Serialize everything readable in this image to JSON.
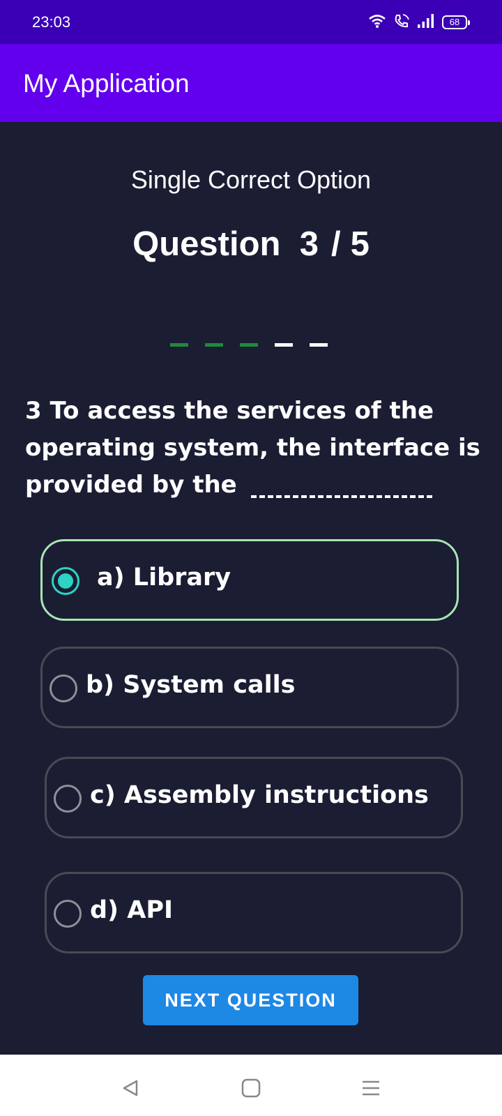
{
  "status_bar": {
    "time": "23:03",
    "battery": "68",
    "icons": [
      "wifi-icon",
      "call-icon",
      "signal-icon",
      "battery-icon"
    ]
  },
  "app_bar": {
    "title": "My Application"
  },
  "quiz": {
    "type": "Single Correct Option",
    "question_word": "Question",
    "current": "3",
    "separator": "/",
    "total": "5",
    "progress": [
      "done",
      "done",
      "done",
      "todo",
      "todo"
    ],
    "question": "3 To access the services of the operating system, the interface is provided by the",
    "options": [
      {
        "label": "a) Library",
        "selected": true
      },
      {
        "label": "b) System calls",
        "selected": false
      },
      {
        "label": "c)  Assembly instructions",
        "selected": false
      },
      {
        "label": "d)  API",
        "selected": false
      }
    ],
    "next_label": "NEXT QUESTION"
  },
  "colors": {
    "status_bar": "#3b00b5",
    "app_bar": "#6200ee",
    "background": "#1b1d33",
    "progress_done": "#1f8a3a",
    "progress_todo": "#ffffff",
    "selected_border": "#a8e6b2",
    "radio_checked": "#2bd4c4",
    "button": "#1e88e5"
  },
  "nav_bar": {
    "icons": [
      "back-icon",
      "home-icon",
      "recents-icon"
    ]
  }
}
